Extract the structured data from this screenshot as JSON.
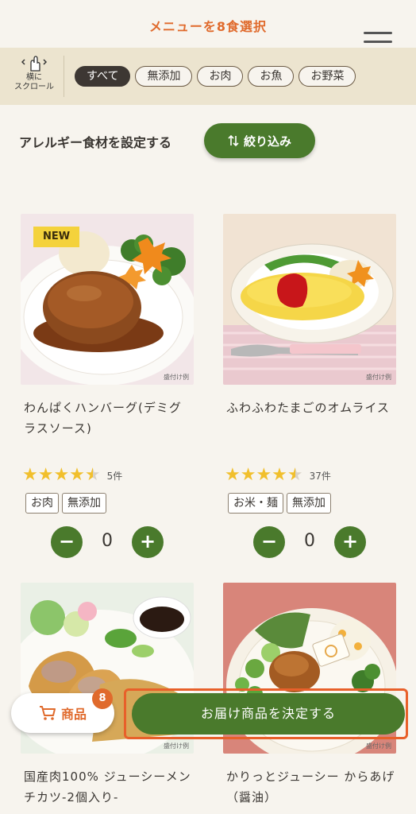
{
  "header": {
    "title": "メニューを8食選択"
  },
  "scroll_hint": {
    "line1": "横に",
    "line2": "スクロール"
  },
  "categories": [
    {
      "label": "すべて",
      "active": true
    },
    {
      "label": "無添加"
    },
    {
      "label": "お肉"
    },
    {
      "label": "お魚"
    },
    {
      "label": "お野菜"
    }
  ],
  "allergy": {
    "label": "アレルギー食材を設定する",
    "filter_label": "絞り込み"
  },
  "products": [
    {
      "name": "わんぱくハンバーグ(デミグラスソース)",
      "badge": "NEW",
      "example": "盛付け例",
      "rating": 4.5,
      "rating_count": "5件",
      "tags": [
        "お肉",
        "無添加"
      ],
      "quantity": "0"
    },
    {
      "name": "ふわふわたまごのオムライス",
      "example": "盛付け例",
      "rating": 4.5,
      "rating_count": "37件",
      "tags": [
        "お米・麺",
        "無添加"
      ],
      "quantity": "0"
    },
    {
      "name": "国産肉100% ジューシーメンチカツ-2個入り-",
      "example": "盛付け例"
    },
    {
      "name": "かりっとジューシー からあげ（醤油）",
      "example": "盛付け例"
    }
  ],
  "footer": {
    "cart_label": "商品",
    "cart_count": "8",
    "confirm_label": "お届け商品を決定する"
  },
  "colors": {
    "accent_green": "#4a7a2c",
    "accent_orange": "#e06a2c",
    "star": "#f1bf2c"
  }
}
